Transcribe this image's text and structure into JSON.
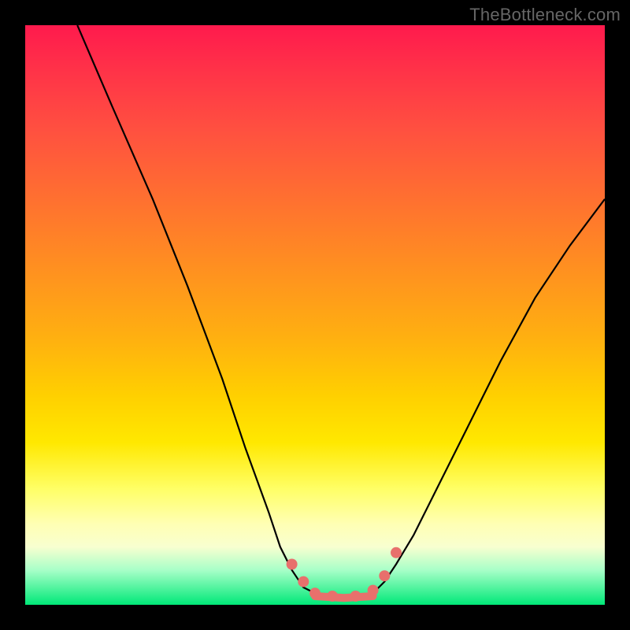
{
  "watermark": "TheBottleneck.com",
  "chart_data": {
    "type": "line",
    "title": "",
    "xlabel": "",
    "ylabel": "",
    "xlim": [
      0,
      100
    ],
    "ylim": [
      0,
      100
    ],
    "series": [
      {
        "name": "curve-left",
        "x": [
          9,
          15,
          22,
          28,
          34,
          38,
          42,
          44,
          46,
          48,
          50
        ],
        "y": [
          100,
          86,
          70,
          55,
          39,
          27,
          16,
          10,
          6,
          3,
          2
        ]
      },
      {
        "name": "curve-right",
        "x": [
          60,
          62,
          64,
          67,
          71,
          76,
          82,
          88,
          94,
          100
        ],
        "y": [
          2,
          4,
          7,
          12,
          20,
          30,
          42,
          53,
          62,
          70
        ]
      },
      {
        "name": "flat-bottom",
        "x": [
          50,
          55,
          60
        ],
        "y": [
          1.5,
          1.2,
          1.5
        ]
      }
    ],
    "markers": {
      "name": "highlight-dots",
      "color": "#e8706c",
      "points": [
        {
          "x": 46,
          "y": 7
        },
        {
          "x": 48,
          "y": 4
        },
        {
          "x": 50,
          "y": 2
        },
        {
          "x": 53,
          "y": 1.5
        },
        {
          "x": 57,
          "y": 1.5
        },
        {
          "x": 60,
          "y": 2.5
        },
        {
          "x": 62,
          "y": 5
        },
        {
          "x": 64,
          "y": 9
        }
      ]
    },
    "background_gradient": {
      "top": "#ff1a4d",
      "mid": "#ffe800",
      "bottom": "#00e878"
    }
  }
}
